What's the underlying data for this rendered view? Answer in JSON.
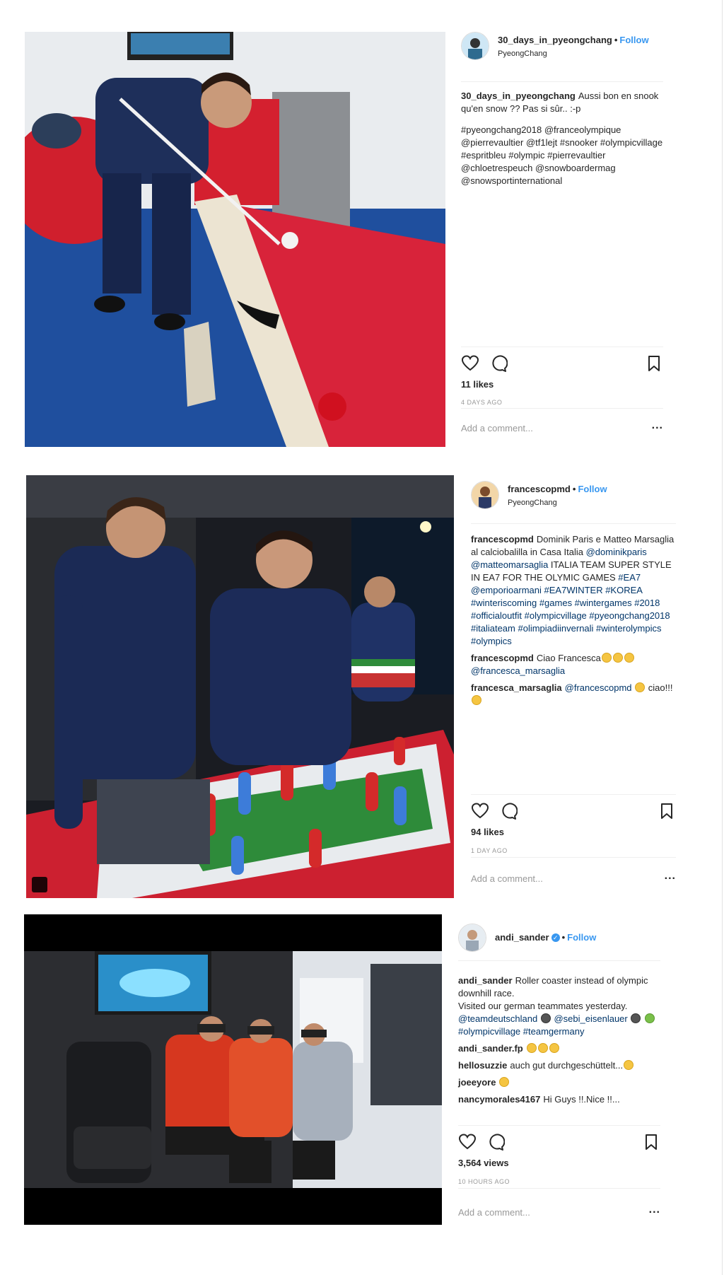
{
  "posts": [
    {
      "username": "30_days_in_pyeongchang",
      "follow_label": "Follow",
      "location": "PyeongChang",
      "caption_user": "30_days_in_pyeongchang",
      "caption_text": "Aussi bon en snook qu'en snow ?? Pas si sûr.. :-p",
      "hashtags": "#pyeongchang2018 @franceolympique @pierrevaultier @tf1lejt #snooker #olympicvillage #espritbleu #olympic #pierrevaultier @chloetrespeuch @snowboardermag @snowsportinternational",
      "likes": "11 likes",
      "time": "4 DAYS AGO",
      "add_comment_placeholder": "Add a comment...",
      "more_label": "..."
    },
    {
      "username": "francescopmd",
      "follow_label": "Follow",
      "location": "PyeongChang",
      "caption_user": "francescopmd",
      "caption_text": "Dominik Paris e Matteo Marsaglia al calciobalilla in Casa Italia",
      "hashtags": "@dominikparis @matteomarsaglia",
      "caption_text2": "ITALIA TEAM SUPER STYLE IN EA7 FOR THE OLYMIC GAMES",
      "hashtags2": "#EA7 @emporioarmani #EA7WINTER #KOREA #winteriscoming #games #wintergames #2018 #officialoutfit #olympicvillage #pyeongchang2018 #italiateam #olimpiadiinvernali #winterolympics #olympics",
      "comment1_user": "francescopmd",
      "comment1_text": "Ciao Francesca",
      "comment1_tag": "@francesca_marsaglia",
      "comment2_user": "francesca_marsaglia",
      "comment2_tag": "@francescopmd",
      "comment2_text": "ciao!!!",
      "likes": "94 likes",
      "time": "1 DAY AGO",
      "add_comment_placeholder": "Add a comment...",
      "more_label": "..."
    },
    {
      "username": "andi_sander",
      "follow_label": "Follow",
      "caption_user": "andi_sander",
      "caption_text": "Roller coaster instead of olympic downhill race.",
      "caption_text2": "Visited our german teammates yesterday.",
      "hashtags": "@teamdeutschland",
      "hashtags2": "@sebi_eisenlauer",
      "hashtags3": "#olympicvillage #teamgermany",
      "comment1_user": "andi_sander.fp",
      "comment2_user": "hellosuzzie",
      "comment2_text": "auch gut durchgeschüttelt...",
      "comment3_user": "joeeyore",
      "comment4_user": "nancymorales4167",
      "comment4_text": "Hi Guys !!.Nice !!...",
      "views": "3,564 views",
      "time": "10 HOURS AGO",
      "add_comment_placeholder": "Add a comment...",
      "more_label": "..."
    }
  ],
  "colors": {
    "link": "#003569",
    "follow": "#3897f0",
    "muted": "#999999",
    "pool_felt": "#d8233a",
    "carpet": "#1f4f9e"
  }
}
